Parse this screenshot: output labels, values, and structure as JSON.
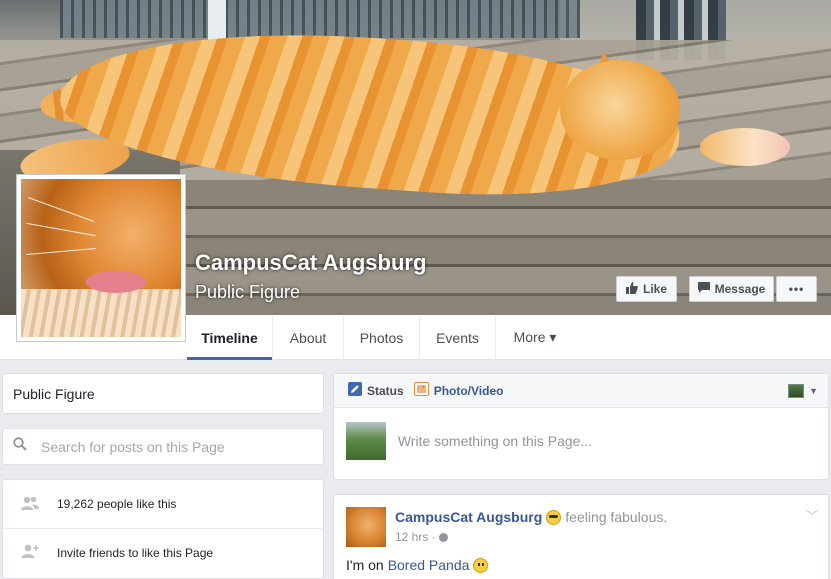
{
  "page": {
    "name": "CampusCat Augsburg",
    "category": "Public Figure"
  },
  "cover_actions": {
    "like_label": "Like",
    "message_label": "Message",
    "more_label": "•••"
  },
  "nav": {
    "tabs": [
      {
        "label": "Timeline",
        "active": true
      },
      {
        "label": "About"
      },
      {
        "label": "Photos"
      },
      {
        "label": "Events"
      },
      {
        "label": "More ▾"
      }
    ]
  },
  "sidebar": {
    "category": "Public Figure",
    "search_placeholder": "Search for posts on this Page",
    "likes_text": "19,262 people like this",
    "invite_text": "Invite friends to like this Page"
  },
  "composer": {
    "status_label": "Status",
    "photo_label": "Photo/Video",
    "placeholder": "Write something on this Page..."
  },
  "post": {
    "author": "CampusCat Augsburg",
    "feeling": "feeling fabulous.",
    "time": "12 hrs ·",
    "text_prefix": "I'm on",
    "link": "Bored Panda"
  },
  "colors": {
    "brand_blue": "#4267b2",
    "link_blue": "#365899",
    "page_bg": "#e9ebee"
  }
}
